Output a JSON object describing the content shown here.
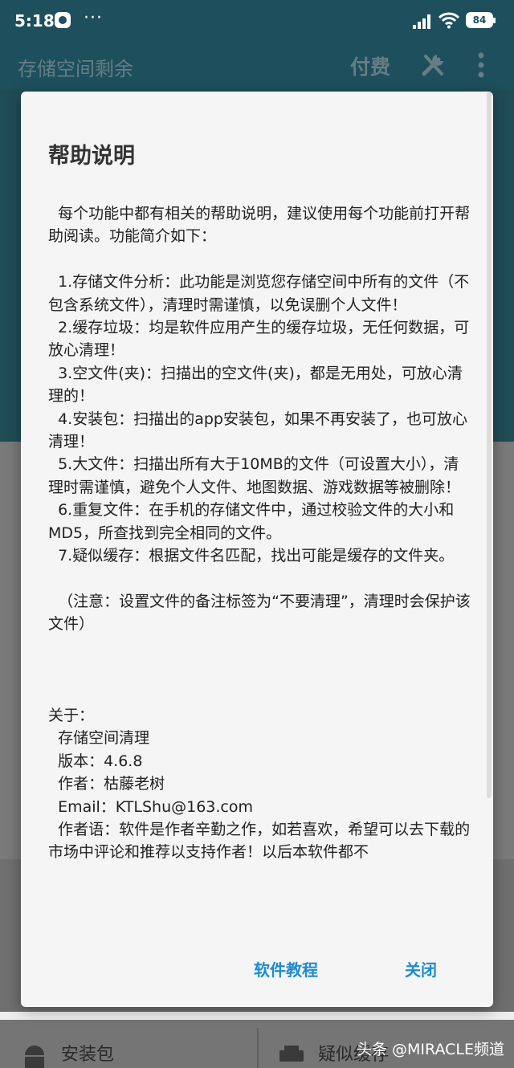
{
  "status_bar": {
    "time": "5:18",
    "more": "···",
    "battery": "84",
    "icons": [
      "app-notification-icon",
      "signal-icon",
      "wifi-icon",
      "battery-icon"
    ]
  },
  "app_bar": {
    "title": "存储空间剩余",
    "pay": "付费",
    "icons": [
      "tools-icon",
      "overflow-menu-icon"
    ]
  },
  "dialog": {
    "title": "帮助说明",
    "paragraphs": [
      "  每个功能中都有相关的帮助说明，建议使用每个功能前打开帮助阅读。功能简介如下：",
      "",
      "  1.存储文件分析：此功能是浏览您存储空间中所有的文件（不包含系统文件），清理时需谨慎，以免误删个人文件！",
      "  2.缓存垃圾：均是软件应用产生的缓存垃圾，无任何数据，可放心清理！",
      "  3.空文件(夹)：扫描出的空文件(夹)，都是无用处，可放心清理的！",
      "  4.安装包：扫描出的app安装包，如果不再安装了，也可放心清理！",
      "  5.大文件：扫描出所有大于10MB的文件（可设置大小），清理时需谨慎，避免个人文件、地图数据、游戏数据等被删除！",
      "  6.重复文件：在手机的存储文件中，通过校验文件的大小和MD5，所查找到完全相同的文件。",
      "  7.疑似缓存：根据文件名匹配，找出可能是缓存的文件夹。",
      "",
      "  （注意：设置文件的备注标签为“不要清理”，清理时会保护该文件）",
      "",
      "",
      "",
      "关于：",
      "  存储空间清理",
      "  版本：4.6.8",
      "  作者：枯藤老树",
      "  Email：KTLShu@163.com",
      "  作者语：软件是作者辛勤之作，如若喜欢，希望可以去下载的市场中评论和推荐以支持作者！以后本软件都不"
    ],
    "buttons": {
      "tutorial": "软件教程",
      "close": "关闭"
    }
  },
  "background": {
    "bottom_items": [
      "安装包",
      "疑似缓存"
    ],
    "watermark": "头条 @MIRACLE频道"
  },
  "colors": {
    "header_bg": "#1d4f5d",
    "accent": "#1f8bd0",
    "dialog_bg": "#f5f5f5"
  }
}
